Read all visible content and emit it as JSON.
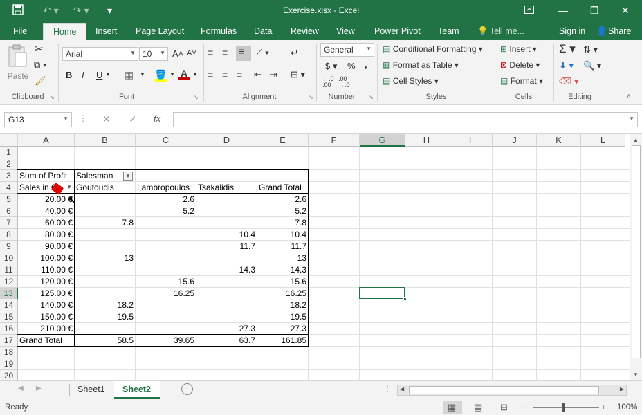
{
  "window": {
    "title": "Exercise.xlsx - Excel"
  },
  "menu": {
    "file": "File",
    "home": "Home",
    "insert": "Insert",
    "page_layout": "Page Layout",
    "formulas": "Formulas",
    "data": "Data",
    "review": "Review",
    "view": "View",
    "power_pivot": "Power Pivot",
    "team": "Team",
    "tell_me": "Tell me...",
    "sign_in": "Sign in",
    "share": "Share"
  },
  "ribbon": {
    "paste": "Paste",
    "clipboard": "Clipboard",
    "font_name": "Arial",
    "font_size": "10",
    "font": "Font",
    "bold": "B",
    "italic": "I",
    "underline": "U",
    "alignment": "Alignment",
    "number_format": "General",
    "number": "Number",
    "conditional_formatting": "Conditional Formatting",
    "format_as_table": "Format as Table",
    "cell_styles": "Cell Styles",
    "styles": "Styles",
    "insert": "Insert",
    "delete": "Delete",
    "format": "Format",
    "cells": "Cells",
    "editing": "Editing",
    "currency": "$",
    "percent": "%",
    "comma": ","
  },
  "formula": {
    "name_box": "G13",
    "fx": "fx",
    "content": ""
  },
  "columns": [
    "A",
    "B",
    "C",
    "D",
    "E",
    "F",
    "G",
    "H",
    "I",
    "J",
    "K",
    "L"
  ],
  "rows": [
    "1",
    "2",
    "3",
    "4",
    "5",
    "6",
    "7",
    "8",
    "9",
    "10",
    "11",
    "12",
    "13",
    "14",
    "15",
    "16",
    "17",
    "18",
    "19",
    "20"
  ],
  "pivot": {
    "sum_label": "Sum of Profit",
    "col_field": "Salesman",
    "row_field": "Sales in €",
    "headers": [
      "Goutoudis",
      "Lambropoulos",
      "Tsakalidis",
      "Grand Total"
    ],
    "rows": [
      {
        "label": "20.00 €",
        "b": "",
        "c": "2.6",
        "d": "",
        "e": "2.6"
      },
      {
        "label": "40.00 €",
        "b": "",
        "c": "5.2",
        "d": "",
        "e": "5.2"
      },
      {
        "label": "60.00 €",
        "b": "7.8",
        "c": "",
        "d": "",
        "e": "7.8"
      },
      {
        "label": "80.00 €",
        "b": "",
        "c": "",
        "d": "10.4",
        "e": "10.4"
      },
      {
        "label": "90.00 €",
        "b": "",
        "c": "",
        "d": "11.7",
        "e": "11.7"
      },
      {
        "label": "100.00 €",
        "b": "13",
        "c": "",
        "d": "",
        "e": "13"
      },
      {
        "label": "110.00 €",
        "b": "",
        "c": "",
        "d": "14.3",
        "e": "14.3"
      },
      {
        "label": "120.00 €",
        "b": "",
        "c": "15.6",
        "d": "",
        "e": "15.6"
      },
      {
        "label": "125.00 €",
        "b": "",
        "c": "16.25",
        "d": "",
        "e": "16.25"
      },
      {
        "label": "140.00 €",
        "b": "18.2",
        "c": "",
        "d": "",
        "e": "18.2"
      },
      {
        "label": "150.00 €",
        "b": "19.5",
        "c": "",
        "d": "",
        "e": "19.5"
      },
      {
        "label": "210.00 €",
        "b": "",
        "c": "",
        "d": "27.3",
        "e": "27.3"
      }
    ],
    "total": {
      "label": "Grand Total",
      "b": "58.5",
      "c": "39.65",
      "d": "63.7",
      "e": "161.85"
    }
  },
  "sheets": {
    "sheet1": "Sheet1",
    "sheet2": "Sheet2"
  },
  "status": {
    "ready": "Ready",
    "zoom": "100%"
  },
  "colors": {
    "accent": "#217346",
    "selection": "#217346"
  }
}
